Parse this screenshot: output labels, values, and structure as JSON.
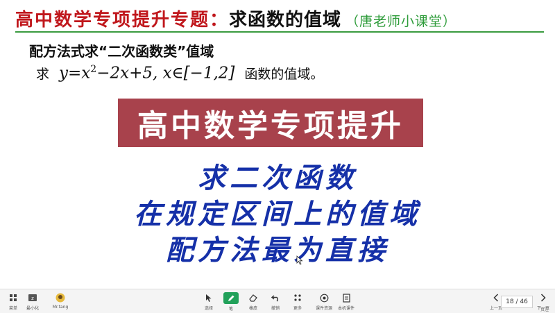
{
  "slide": {
    "title_main": "高中数学专项提升专题：",
    "title_topic": "求函数的值域",
    "title_teacher": "（唐老师小课堂）",
    "method_heading": "配方法式求“二次函数类”值域",
    "problem": {
      "prefix": "求",
      "formula_part1": "y=x",
      "formula_exp": "2",
      "formula_part2": "−2x+5, x∈[−1,2]",
      "suffix": "函数的值域。"
    },
    "banner": "高中数学专项提升",
    "line1": "求二次函数",
    "line2": "在规定区间上的值域",
    "line3": "配方法最为直接"
  },
  "toolbar": {
    "left": [
      {
        "name": "menu",
        "label": "菜单",
        "icon": "grid-icon"
      },
      {
        "name": "minimize",
        "label": "最小化",
        "icon": "minimize-icon"
      },
      {
        "name": "mr-tang",
        "label": "Mr.tang",
        "icon": "avatar-icon"
      }
    ],
    "center": [
      {
        "name": "select",
        "label": "选择",
        "icon": "cursor-icon"
      },
      {
        "name": "pen",
        "label": "笔",
        "icon": "pen-icon"
      },
      {
        "name": "eraser",
        "label": "橡皮",
        "icon": "eraser-icon"
      },
      {
        "name": "undo",
        "label": "撤销",
        "icon": "undo-icon"
      },
      {
        "name": "more",
        "label": "更多",
        "icon": "more-icon"
      },
      {
        "name": "courseware-library",
        "label": "课件资源",
        "icon": "library-icon"
      },
      {
        "name": "courseware",
        "label": "本机课件",
        "icon": "file-icon"
      }
    ],
    "right": {
      "prev_label": "上一页",
      "page_indicator": "18 / 46",
      "notes_label": "页注",
      "next_label": "下一页"
    }
  }
}
